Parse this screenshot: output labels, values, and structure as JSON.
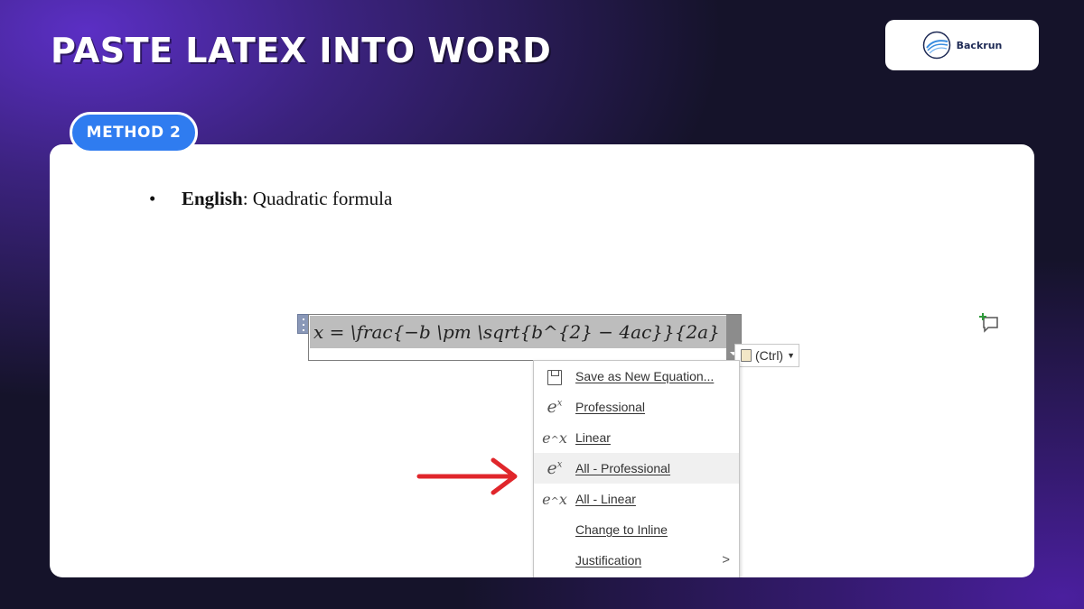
{
  "headline": "PASTE LATEX INTO WORD",
  "brand": {
    "name": "Backrun"
  },
  "method_badge": "METHOD 2",
  "document": {
    "bullet_bold": "English",
    "bullet_rest": ": Quadratic formula",
    "equation": "x  = \\frac{−b \\pm \\sqrt{b^{2} − 4ac}}{2a}",
    "paste_options_label": "(Ctrl)"
  },
  "menu": {
    "items": [
      {
        "label": "Save as New Equation...",
        "icon": "save-icon"
      },
      {
        "label": "Professional",
        "icon": "professional-format-icon"
      },
      {
        "label": "Linear",
        "icon": "linear-format-icon"
      },
      {
        "label": "All - Professional",
        "icon": "professional-format-icon",
        "highlighted": true
      },
      {
        "label": "All - Linear",
        "icon": "linear-format-icon"
      },
      {
        "label": "Change to Inline"
      },
      {
        "label": "Justification",
        "submenu": true
      }
    ]
  },
  "colors": {
    "badge": "#2f7cf0",
    "arrow": "#e0262b",
    "equation_highlight": "#bdbdbd"
  }
}
